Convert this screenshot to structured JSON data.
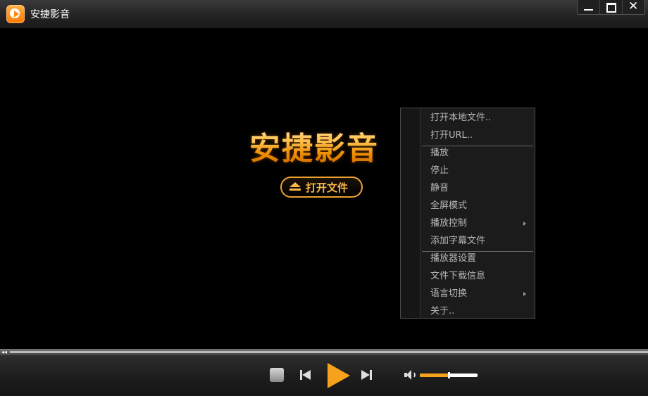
{
  "window": {
    "title": "安捷影音",
    "icons": {
      "app": "player-logo-icon",
      "minimize": "minimize-icon",
      "maximize": "maximize-icon",
      "close": "close-icon"
    },
    "close_glyph": "✕"
  },
  "main": {
    "logo_text": "安捷影音",
    "open_file_label": "打开文件"
  },
  "context_menu": {
    "items": [
      {
        "label": "打开本地文件.."
      },
      {
        "label": "打开URL.."
      },
      {
        "label": "播放"
      },
      {
        "label": "停止"
      },
      {
        "label": "静音"
      },
      {
        "label": "全屏模式"
      },
      {
        "label": "播放控制",
        "submenu": true
      },
      {
        "label": "添加字幕文件"
      },
      {
        "label": "播放器设置"
      },
      {
        "label": "文件下载信息"
      },
      {
        "label": "语言切换",
        "submenu": true
      },
      {
        "label": "关于.."
      }
    ]
  },
  "controls": {
    "icons": {
      "stop": "stop-icon",
      "prev": "previous-icon",
      "play": "play-icon",
      "next": "next-icon",
      "volume": "speaker-icon",
      "rewind": "rewind-icon"
    },
    "volume_level": 0.5,
    "rewind_glyph": "◂◂"
  },
  "colors": {
    "accent": "#f6a21c",
    "menu_text": "#b8b8b8",
    "menu_bg": "#1b1b1b"
  }
}
